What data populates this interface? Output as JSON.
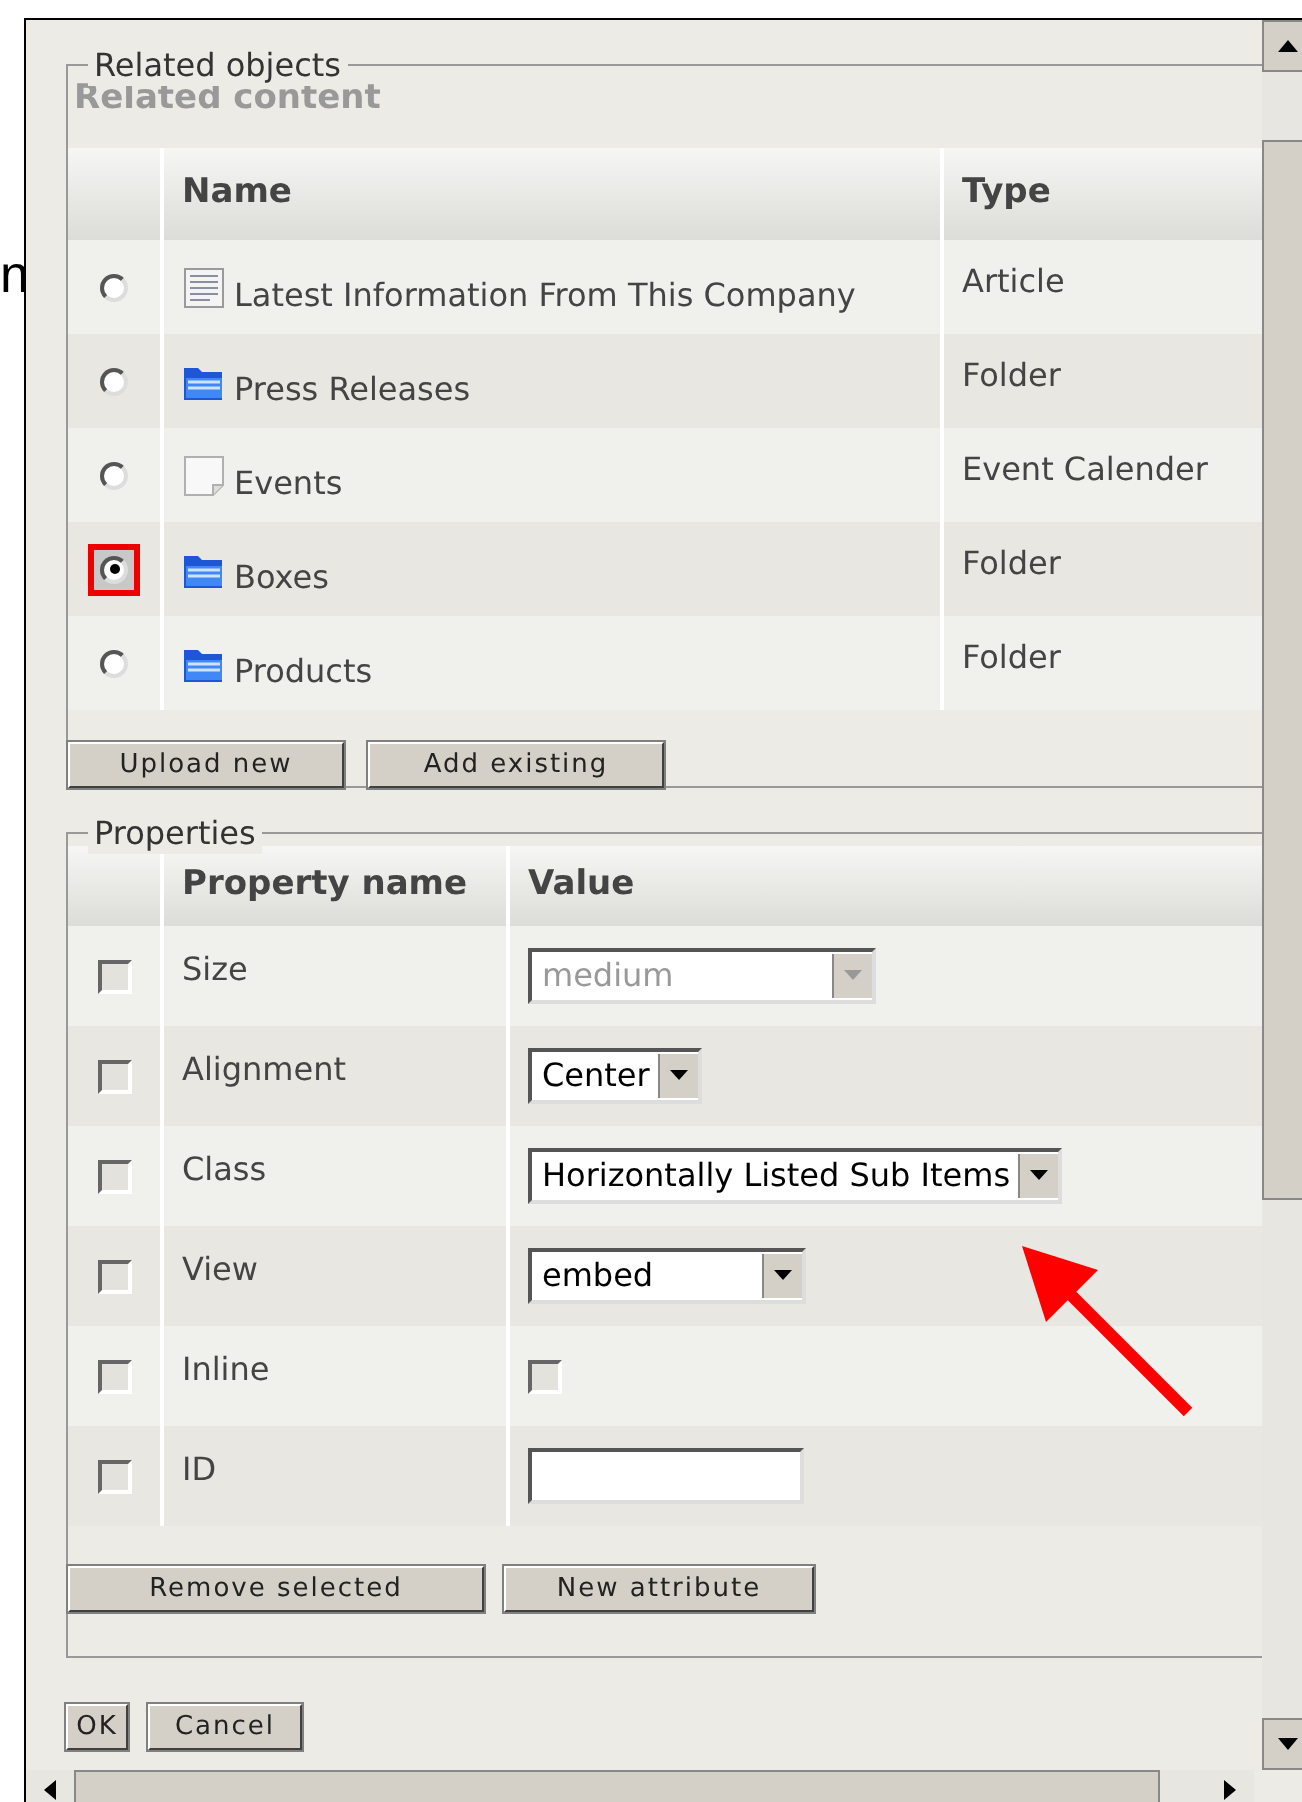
{
  "outside_text": "n",
  "related": {
    "legend": "Related objects",
    "subtitle": "Related content",
    "columns": [
      "Name",
      "Type"
    ],
    "rows": [
      {
        "name": "Latest Information From This Company",
        "type": "Article",
        "kind": "article",
        "selected": false
      },
      {
        "name": "Press Releases",
        "type": "Folder",
        "kind": "folder",
        "selected": false
      },
      {
        "name": "Events",
        "type": "Event Calender",
        "kind": "page",
        "selected": false
      },
      {
        "name": "Boxes",
        "type": "Folder",
        "kind": "folder",
        "selected": true
      },
      {
        "name": "Products",
        "type": "Folder",
        "kind": "folder",
        "selected": false
      }
    ],
    "buttons": [
      "Upload new",
      "Add existing"
    ]
  },
  "properties": {
    "legend": "Properties",
    "columns": [
      "Property name",
      "Value"
    ],
    "rows": [
      {
        "name": "Size",
        "checked": false,
        "kind": "select",
        "value": "medium",
        "disabled": true
      },
      {
        "name": "Alignment",
        "checked": false,
        "kind": "select",
        "value": "Center",
        "disabled": false
      },
      {
        "name": "Class",
        "checked": false,
        "kind": "select",
        "value": "Horizontally Listed Sub Items",
        "disabled": false
      },
      {
        "name": "View",
        "checked": false,
        "kind": "select",
        "value": "embed",
        "disabled": false
      },
      {
        "name": "Inline",
        "checked": false,
        "kind": "checkbox",
        "value_checked": false
      },
      {
        "name": "ID",
        "checked": false,
        "kind": "text"
      }
    ],
    "buttons": [
      "Remove selected",
      "New attribute"
    ]
  },
  "footer_buttons": [
    "OK",
    "Cancel"
  ]
}
